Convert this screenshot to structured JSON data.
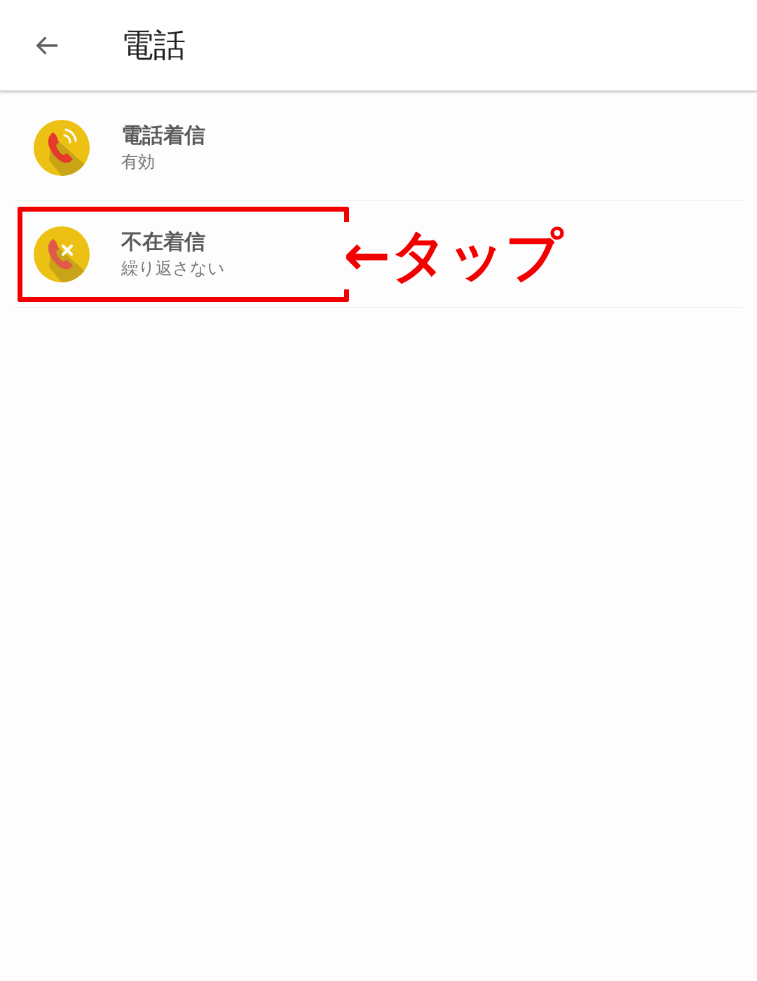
{
  "header": {
    "title": "電話"
  },
  "items": [
    {
      "kind": "incoming",
      "title": "電話着信",
      "subtitle": "有効",
      "highlighted": false
    },
    {
      "kind": "missed",
      "title": "不在着信",
      "subtitle": "繰り返さない",
      "highlighted": true
    }
  ],
  "annotation": {
    "text": "←タップ"
  }
}
